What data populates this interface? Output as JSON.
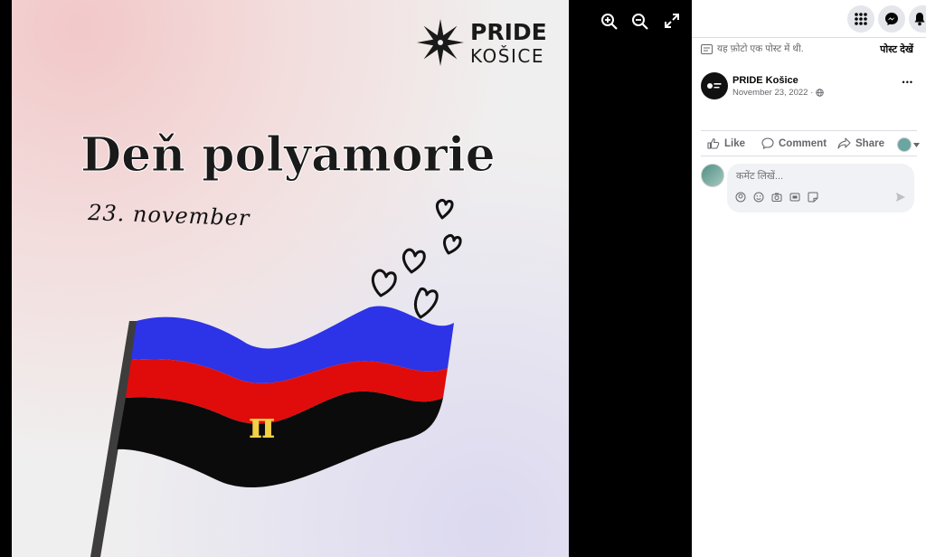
{
  "photo": {
    "brand_top": "PRIDE",
    "brand_bottom": "KOŠICE",
    "headline": "Deň polyamorie",
    "date": "23. november",
    "flag_symbol": "π"
  },
  "viewer_tools": {
    "zoom_in": "zoom-in-icon",
    "zoom_out": "zoom-out-icon",
    "fullscreen": "expand-icon"
  },
  "panel": {
    "notice": "यह फ़ोटो एक पोस्ट में थी.",
    "view_post": "पोस्ट देखें",
    "author": "PRIDE Košice",
    "timestamp": "November 23, 2022 ·",
    "more": "•••",
    "actions": {
      "like": "Like",
      "comment": "Comment",
      "share": "Share"
    },
    "comment_placeholder": "कमेंट लिखें...",
    "colors": {
      "bg": "#ffffff",
      "muted": "#65676b",
      "input_bg": "#f0f2f5",
      "btn_bg": "#e4e6eb"
    }
  }
}
